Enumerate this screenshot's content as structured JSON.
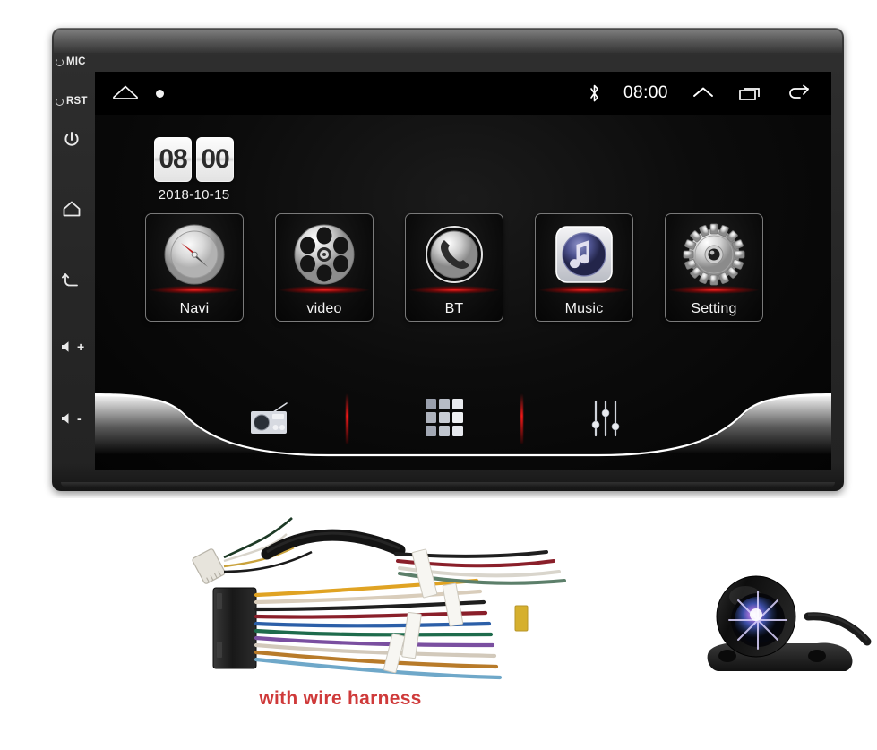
{
  "product": {
    "type": "car-stereo-head-unit",
    "caption": "with wire harness",
    "caption_color": "#cf3a3a"
  },
  "bezel": {
    "buttons": [
      {
        "name": "mic",
        "label": "MIC",
        "icon": "led-ring-icon"
      },
      {
        "name": "reset",
        "label": "RST",
        "icon": "led-ring-icon"
      },
      {
        "name": "power",
        "label": "",
        "icon": "power-icon"
      },
      {
        "name": "home",
        "label": "",
        "icon": "home-icon"
      },
      {
        "name": "back",
        "label": "",
        "icon": "back-arrow-icon"
      },
      {
        "name": "volume-up",
        "label": "+",
        "icon": "speaker-icon"
      },
      {
        "name": "volume-down",
        "label": "-",
        "icon": "speaker-icon"
      }
    ]
  },
  "status_bar": {
    "home_icon": "home-outline-icon",
    "dot_icon": "white-dot-icon",
    "bluetooth_icon": "bluetooth-icon",
    "clock": "08:00",
    "chevron_icon": "chevron-up-icon",
    "recents_icon": "recent-apps-icon",
    "back_icon": "back-arrow-icon"
  },
  "clock_widget": {
    "hours": "08",
    "minutes": "00",
    "date": "2018-10-15"
  },
  "apps": [
    {
      "label": "Navi",
      "icon": "compass-icon"
    },
    {
      "label": "video",
      "icon": "film-reel-icon"
    },
    {
      "label": "BT",
      "icon": "phone-handset-icon"
    },
    {
      "label": "Music",
      "icon": "music-note-icon"
    },
    {
      "label": "Setting",
      "icon": "gear-icon"
    }
  ],
  "dock": {
    "items": [
      {
        "name": "radio",
        "icon": "radio-icon"
      },
      {
        "name": "all-apps",
        "icon": "app-grid-icon"
      },
      {
        "name": "equalizer",
        "icon": "equalizer-sliders-icon"
      }
    ],
    "divider_color": "#ff1919"
  },
  "accessories": {
    "wire_harness": "wire-harness-photo",
    "camera": "rear-view-camera-photo"
  }
}
